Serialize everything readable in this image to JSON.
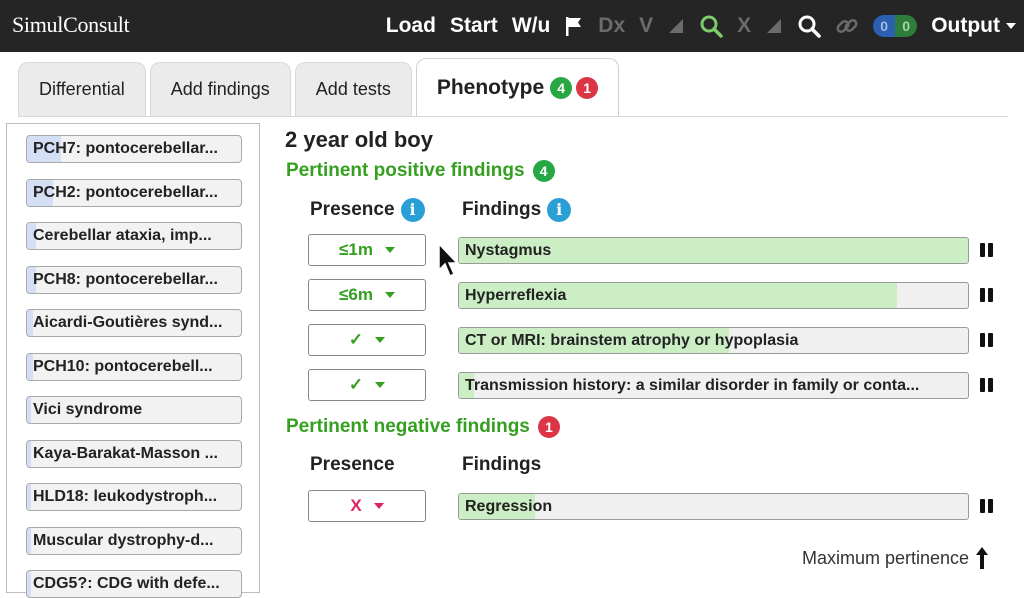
{
  "app": {
    "logo": "SimulConsult"
  },
  "nav": {
    "load": "Load",
    "start": "Start",
    "wu": "W/u",
    "dx": "Dx",
    "v": "V",
    "x": "X",
    "link_count_1": "0",
    "link_count_2": "0",
    "output": "Output"
  },
  "tabs": [
    {
      "label": "Differential"
    },
    {
      "label": "Add findings"
    },
    {
      "label": "Add tests"
    },
    {
      "label": "Phenotype",
      "positive_count": "4",
      "negative_count": "1"
    }
  ],
  "differential": [
    {
      "label": "PCH7: pontocerebellar...",
      "pertinence": 0.16
    },
    {
      "label": "PCH2: pontocerebellar...",
      "pertinence": 0.12
    },
    {
      "label": "Cerebellar ataxia, imp...",
      "pertinence": 0.04
    },
    {
      "label": "PCH8: pontocerebellar...",
      "pertinence": 0.04
    },
    {
      "label": "Aicardi-Goutières synd...",
      "pertinence": 0.03
    },
    {
      "label": "PCH10: pontocerebell...",
      "pertinence": 0.03
    },
    {
      "label": "Vici syndrome",
      "pertinence": 0.02
    },
    {
      "label": "Kaya-Barakat-Masson ...",
      "pertinence": 0.02
    },
    {
      "label": "HLD18: leukodystroph...",
      "pertinence": 0.02
    },
    {
      "label": "Muscular dystrophy-d...",
      "pertinence": 0.02
    },
    {
      "label": "CDG5?: CDG with defe...",
      "pertinence": 0.02
    }
  ],
  "patient": {
    "title": "2 year old boy"
  },
  "positive": {
    "heading": "Pertinent positive findings",
    "count": "4",
    "presence_header": "Presence",
    "findings_header": "Findings",
    "rows": [
      {
        "presence": "≤1m",
        "finding": "Nystagmus",
        "pertinence": 1.0
      },
      {
        "presence": "≤6m",
        "finding": "Hyperreflexia",
        "pertinence": 0.86
      },
      {
        "presence": "✓",
        "finding": "CT or MRI: brainstem atrophy or hypoplasia",
        "pertinence": 0.53
      },
      {
        "presence": "✓",
        "finding": "Transmission history: a similar disorder in family or conta...",
        "pertinence": 0.03
      }
    ]
  },
  "negative": {
    "heading": "Pertinent negative findings",
    "count": "1",
    "presence_header": "Presence",
    "findings_header": "Findings",
    "rows": [
      {
        "presence": "X",
        "finding": "Regression",
        "pertinence": 0.15
      }
    ]
  },
  "footer": {
    "max_pertinence": "Maximum pertinence"
  },
  "icons": {
    "flag": "flag-icon",
    "search": "search-icon",
    "link": "link-icon",
    "info": "info-icon",
    "handle": "drag-handle-icon",
    "arrow_up": "arrow-up-icon"
  },
  "colors": {
    "accent_green": "#35a020",
    "badge_green": "#28a745",
    "badge_red": "#dc3545",
    "info_blue": "#2a9fd6",
    "finding_fill": "#cbeec4",
    "dx_fill": "#d4def5",
    "negative_pink": "#e0245e"
  }
}
